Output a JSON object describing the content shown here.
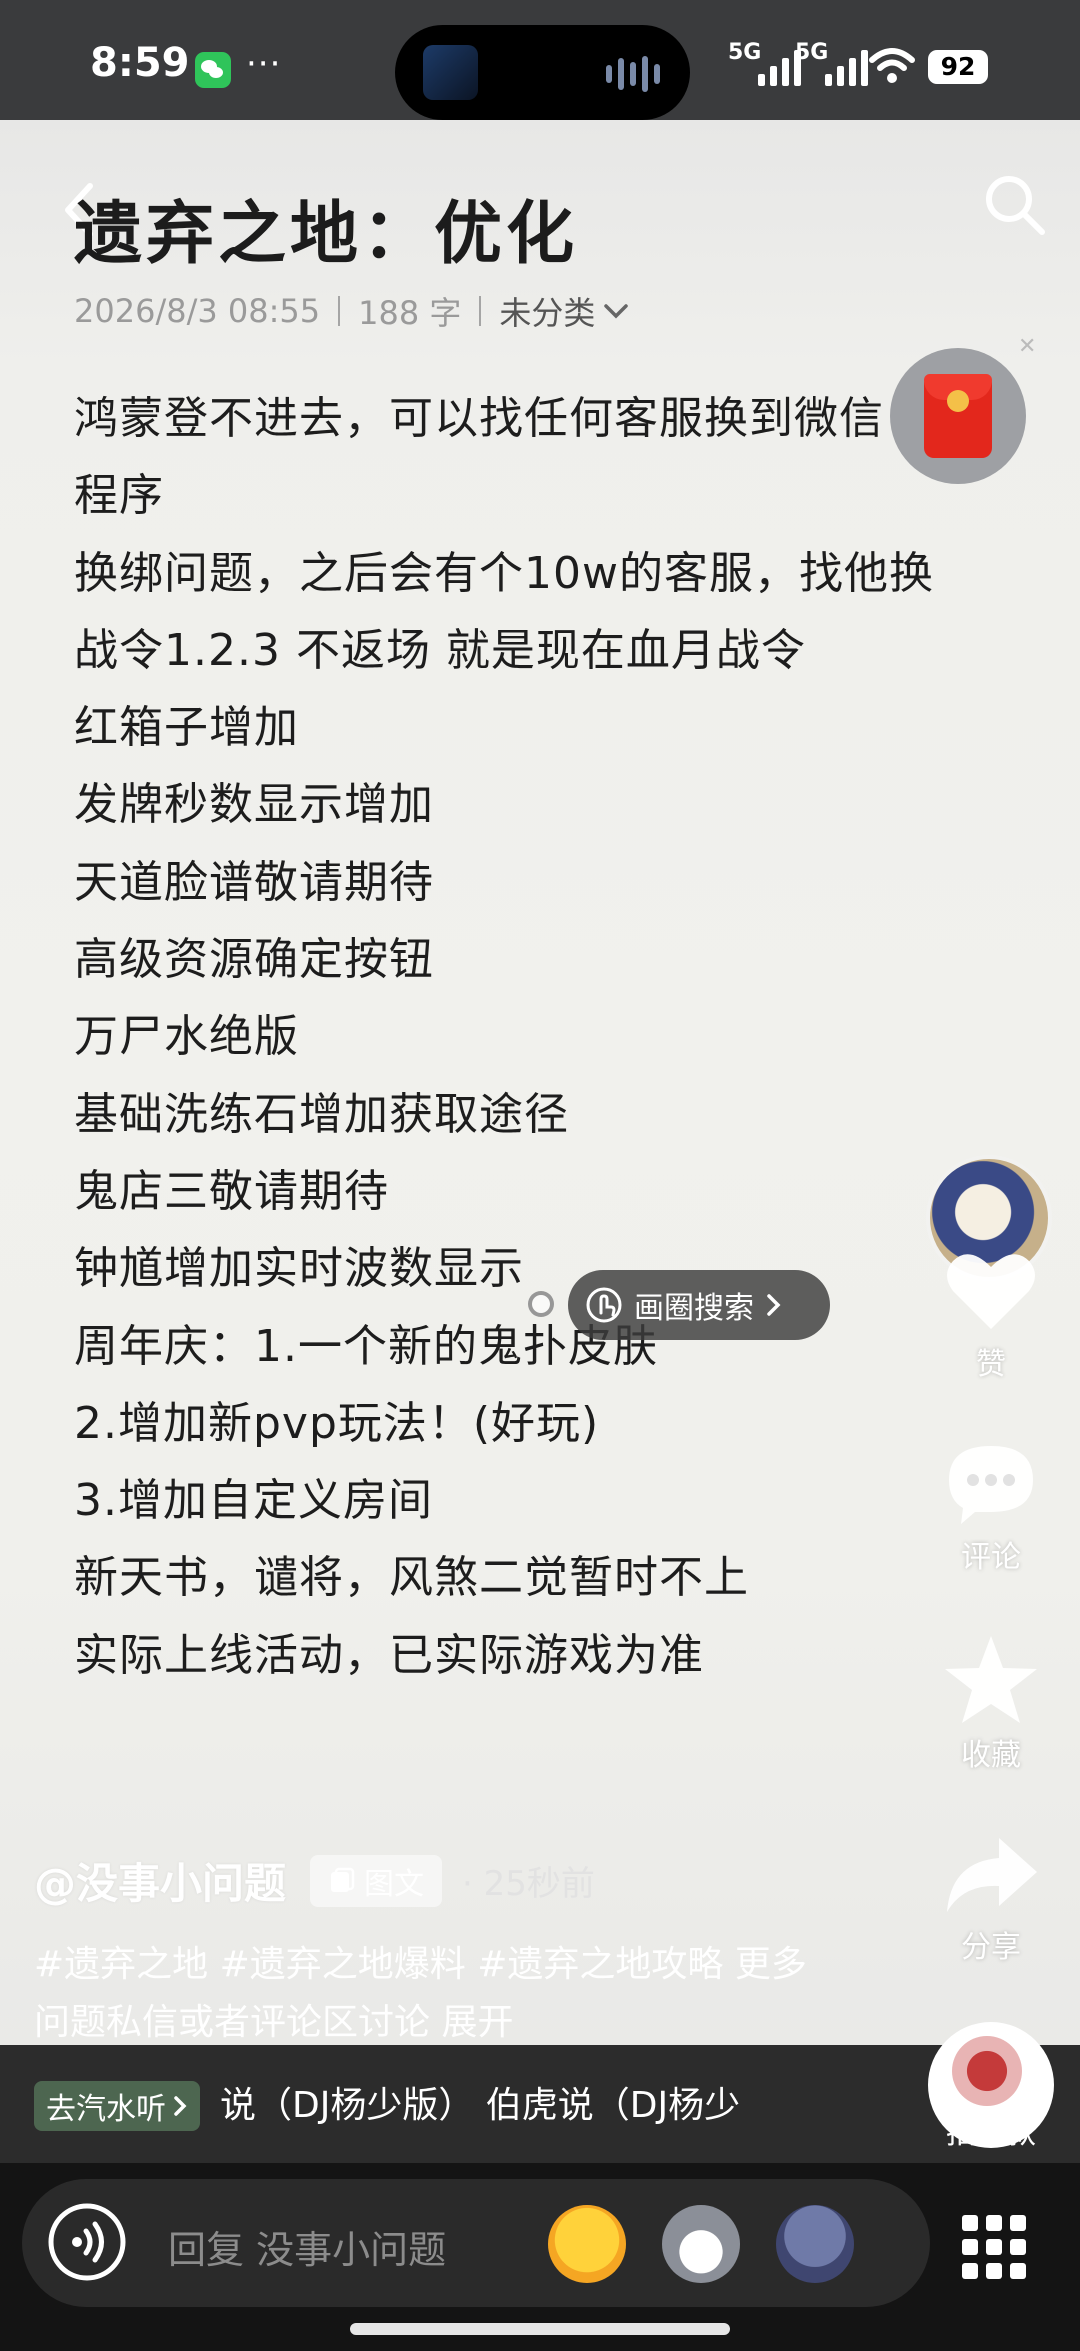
{
  "status_bar": {
    "time": "8:59",
    "dots": "···",
    "network_1": "5G",
    "network_2": "5G",
    "battery": "92"
  },
  "note": {
    "title": "遗弃之地：优化",
    "date": "2026/8/3 08:55",
    "word_count": "188 字",
    "category": "未分类",
    "lines": [
      "鸿蒙登不进去，可以找任何客服换到微信",
      "程序",
      "换绑问题，之后会有个10w的客服，找他换",
      "战令1.2.3 不返场 就是现在血月战令",
      "红箱子增加",
      "发牌秒数显示增加",
      "天道脸谱敬请期待",
      "高级资源确定按钮",
      "万尸水绝版",
      "基础洗练石增加获取途径",
      "鬼店三敬请期待",
      "钟馗增加实时波数显示",
      "周年庆：1.一个新的鬼扑皮肤",
      "2.增加新pvp玩法！(好玩)",
      "3.增加自定义房间",
      "新天书，谴将，风煞二觉暂时不上",
      "实际上线活动，已实际游戏为准"
    ]
  },
  "circle_search": {
    "label": "画圈搜索"
  },
  "side_actions": {
    "like": "赞",
    "comment": "评论",
    "favorite": "收藏",
    "share": "分享",
    "same_style": "拍同款"
  },
  "author": {
    "name": "@没事小问题",
    "type_badge": "图文",
    "time_ago": "· 25秒前"
  },
  "tags": "#遗弃之地 #遗弃之地爆料 #遗弃之地攻略 更多问题私信或者评论区讨论  展开",
  "music": {
    "chip": "去汽水听",
    "marquee": "说（DJ杨少版）    伯虎说（DJ杨少"
  },
  "reply": {
    "placeholder": "回复 没事小问题"
  },
  "colors": {
    "accent_red": "#e3271c",
    "music_chip": "#4d6650"
  }
}
